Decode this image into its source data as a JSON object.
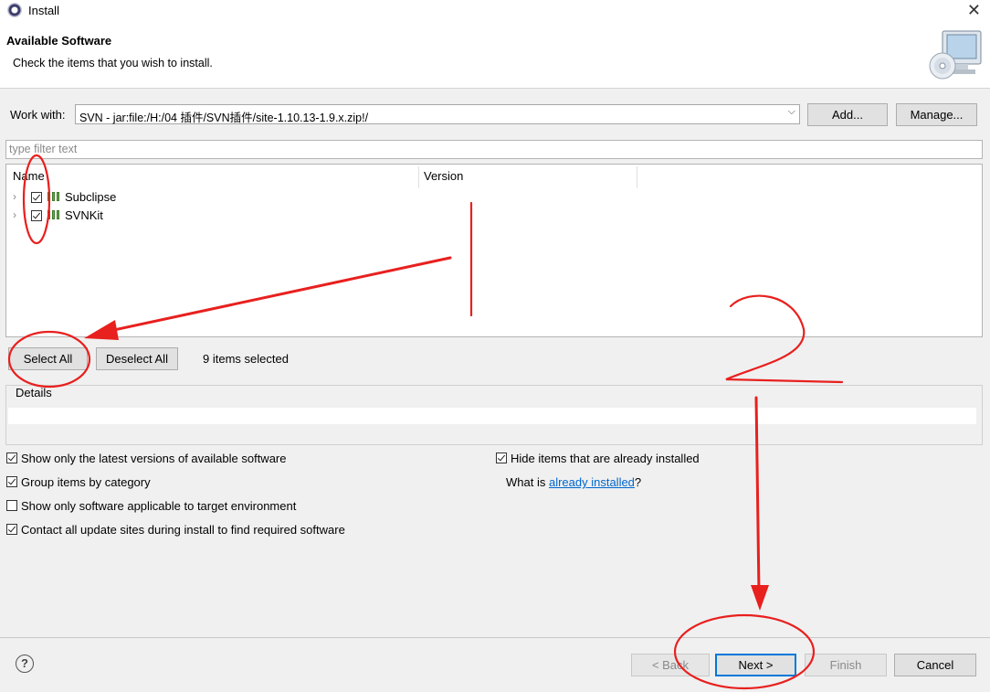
{
  "window": {
    "title": "Install"
  },
  "header": {
    "title": "Available Software",
    "description": "Check the items that you wish to install."
  },
  "work_with": {
    "label": "Work with:",
    "value": "SVN - jar:file:/H:/04 插件/SVN插件/site-1.10.13-1.9.x.zip!/",
    "add_label": "Add...",
    "manage_label": "Manage..."
  },
  "filter": {
    "placeholder": "type filter text"
  },
  "tree": {
    "columns": [
      "Name",
      "Version"
    ],
    "items": [
      {
        "label": "Subclipse",
        "checked": true
      },
      {
        "label": "SVNKit",
        "checked": true
      }
    ]
  },
  "selection": {
    "select_all_label": "Select All",
    "deselect_all_label": "Deselect All",
    "status": "9 items selected"
  },
  "details": {
    "label": "Details"
  },
  "options": [
    {
      "label": "Show only the latest versions of available software",
      "checked": true
    },
    {
      "label": "Group items by category",
      "checked": true
    },
    {
      "label": "Show only software applicable to target environment",
      "checked": false
    },
    {
      "label": "Contact all update sites during install to find required software",
      "checked": true
    },
    {
      "label": "Hide items that are already installed",
      "checked": true
    }
  ],
  "already_installed": {
    "prefix": "What is ",
    "link": "already installed",
    "suffix": "?"
  },
  "footer": {
    "help_icon": "?",
    "back_label": "< Back",
    "next_label": "Next >",
    "finish_label": "Finish",
    "cancel_label": "Cancel"
  },
  "annotations": {
    "step1": "1",
    "step2": "2",
    "color": "#e8201e"
  }
}
